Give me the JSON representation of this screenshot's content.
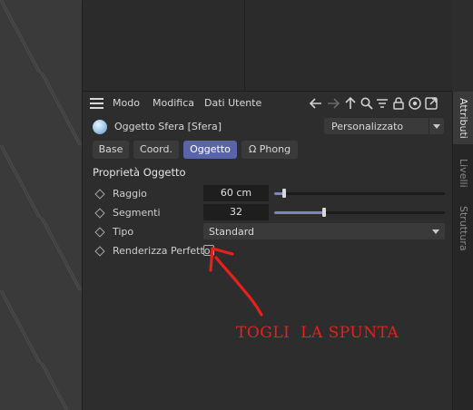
{
  "menubar": {
    "items": [
      "Modo",
      "Modifica",
      "Dati Utente"
    ],
    "icons": [
      "arrow-left-icon",
      "arrow-right-icon",
      "arrow-up-icon",
      "search-icon",
      "filter-icon",
      "lock-icon",
      "target-icon",
      "new-window-icon"
    ]
  },
  "object": {
    "title": "Oggetto Sfera [Sfera]",
    "preset": "Personalizzato"
  },
  "tabs": [
    {
      "label": "Base",
      "active": false
    },
    {
      "label": "Coord.",
      "active": false
    },
    {
      "label": "Oggetto",
      "active": true
    },
    {
      "label": "Ω Phong",
      "active": false
    }
  ],
  "section_title": "Proprietà Oggetto",
  "properties": {
    "radius": {
      "label": "Raggio",
      "value": "60 cm",
      "slider_fraction": 0.06
    },
    "segments": {
      "label": "Segmenti",
      "value": "32",
      "slider_fraction": 0.29
    },
    "type": {
      "label": "Tipo",
      "value": "Standard"
    },
    "render_perfect": {
      "label": "Renderizza Perfetto",
      "checked": false
    }
  },
  "side_tabs": [
    {
      "label": "Attributi",
      "active": true
    },
    {
      "label": "Livelli",
      "active": false
    },
    {
      "label": "Struttura",
      "active": false
    }
  ],
  "annotation": {
    "text": "TOGLI  LA SPUNTA",
    "color": "#e8201c"
  },
  "colors": {
    "accent": "#5a64a8",
    "slider_fill": "#7f86c2"
  }
}
